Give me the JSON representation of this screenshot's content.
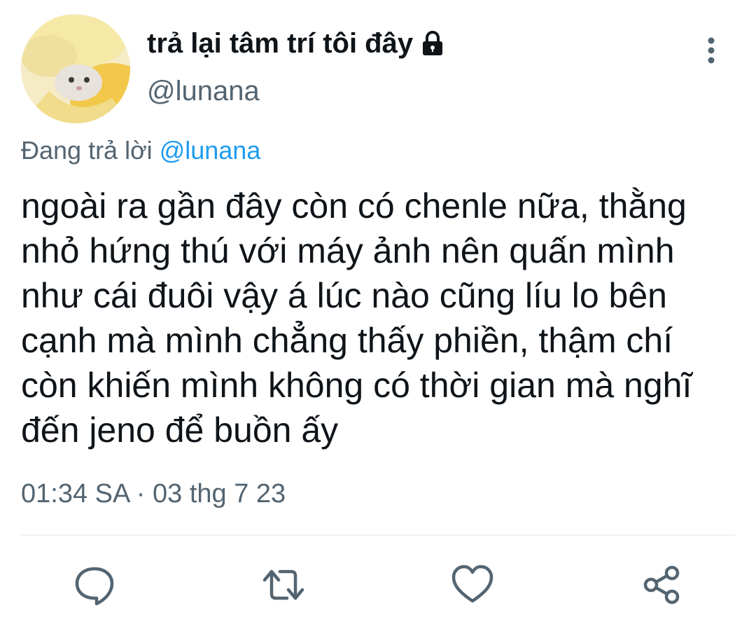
{
  "tweet": {
    "display_name": "trả lại tâm trí tôi đây",
    "handle": "@lunana",
    "protected_icon": "lock-icon",
    "more_icon": "more-vertical-icon",
    "reply_prefix": "Đang trả lời",
    "reply_to": "@lunana",
    "text_lines": [
      "ngoài ra gần đây còn có chenle nữa, thằng",
      "nhỏ hứng thú với máy ảnh nên quấn mình",
      "như cái đuôi vậy á lúc nào cũng líu lo bên",
      "cạnh mà mình chẳng thấy phiền, thậm chí",
      "còn khiến mình không có thời gian mà nghĩ",
      "đến jeno để buồn ấy"
    ],
    "timestamp": "01:34 SA · 03 thg 7 23"
  },
  "actions": {
    "reply_icon": "comment-icon",
    "retweet_icon": "retweet-icon",
    "like_icon": "heart-icon",
    "share_icon": "share-icon"
  },
  "colors": {
    "text_primary": "#0f1419",
    "text_secondary": "#536471",
    "link": "#1d9bf0",
    "divider": "#eff3f4"
  }
}
